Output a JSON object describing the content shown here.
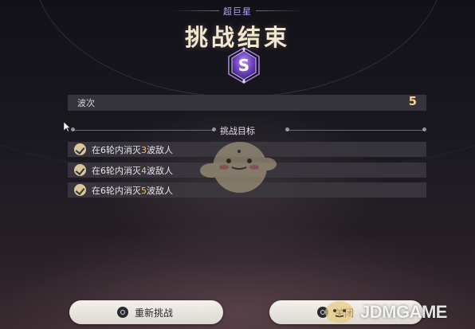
{
  "header": {
    "subtitle": "超巨星",
    "title": "挑战结束",
    "rank": "S",
    "rank_color": "#7a4fc8"
  },
  "wave": {
    "label": "波次",
    "value": "5",
    "value_color": "#f0d28a"
  },
  "goals": {
    "header": "挑战目标",
    "items": [
      {
        "prefix": "在6轮内消灭",
        "count": "3",
        "suffix": "波敌人",
        "completed": true
      },
      {
        "prefix": "在6轮内消灭",
        "count": "4",
        "suffix": "波敌人",
        "completed": true
      },
      {
        "prefix": "在6轮内消灭",
        "count": "5",
        "suffix": "波敌人",
        "completed": true
      }
    ],
    "highlight_color": "#f0c070"
  },
  "buttons": {
    "retry_label": "重新挑战",
    "exit_label": "关闭",
    "retry_icon": "controller-button-icon",
    "exit_icon": "controller-button-icon"
  },
  "watermark": {
    "text": "JDMGAME"
  }
}
